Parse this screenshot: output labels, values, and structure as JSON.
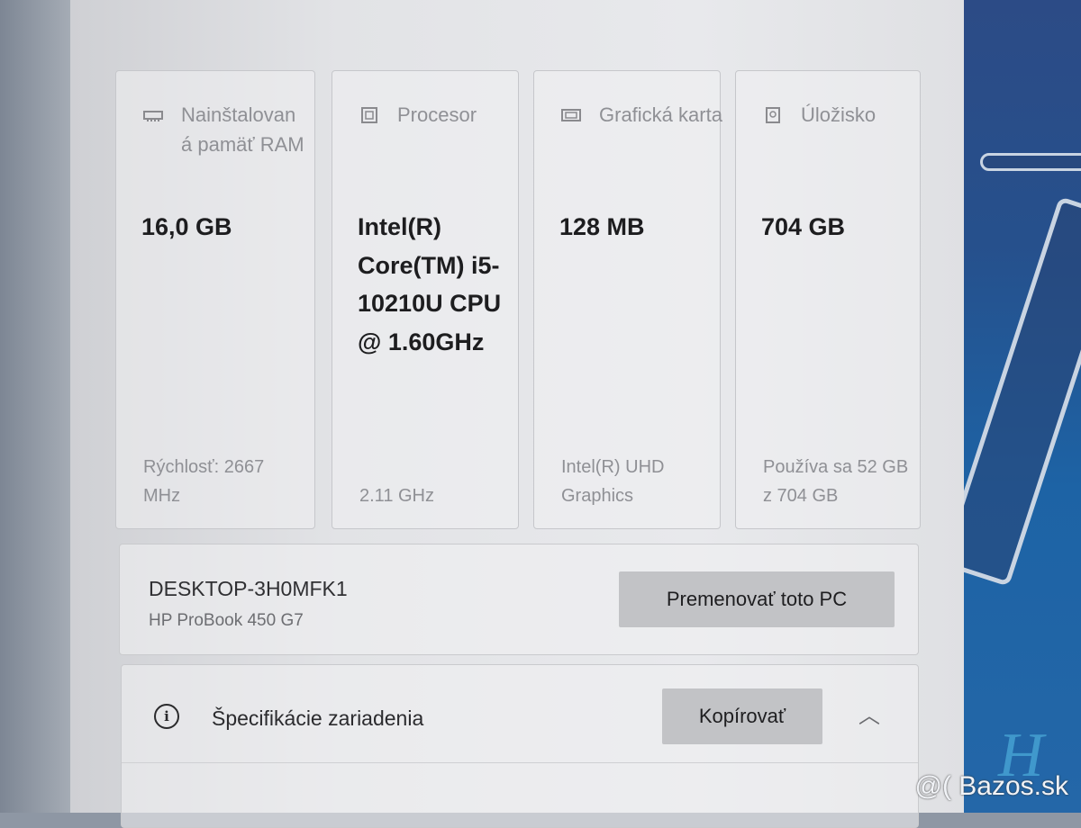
{
  "cards": [
    {
      "icon": "ram-icon",
      "label": "Nainštalovan á pamäť RAM",
      "value": "16,0 GB",
      "sub": "Rýchlosť: 2667 MHz"
    },
    {
      "icon": "processor-icon",
      "label": "Procesor",
      "value": "Intel(R) Core(TM) i5-10210U CPU @ 1.60GHz",
      "sub": "2.11 GHz"
    },
    {
      "icon": "graphics-card-icon",
      "label": "Grafická karta",
      "value": "128 MB",
      "sub": "Intel(R) UHD Graphics"
    },
    {
      "icon": "storage-icon",
      "label": "Úložisko",
      "value": "704 GB",
      "sub": "Používa sa 52 GB z 704 GB"
    }
  ],
  "device": {
    "name": "DESKTOP-3H0MFK1",
    "model": "HP ProBook 450 G7",
    "rename_label": "Premenovať toto PC"
  },
  "specs": {
    "info_icon": "i",
    "title": "Špecifikácie zariadenia",
    "copy_label": "Kopírovať",
    "chevron": "︿"
  },
  "watermark": "@( Bazos.sk"
}
